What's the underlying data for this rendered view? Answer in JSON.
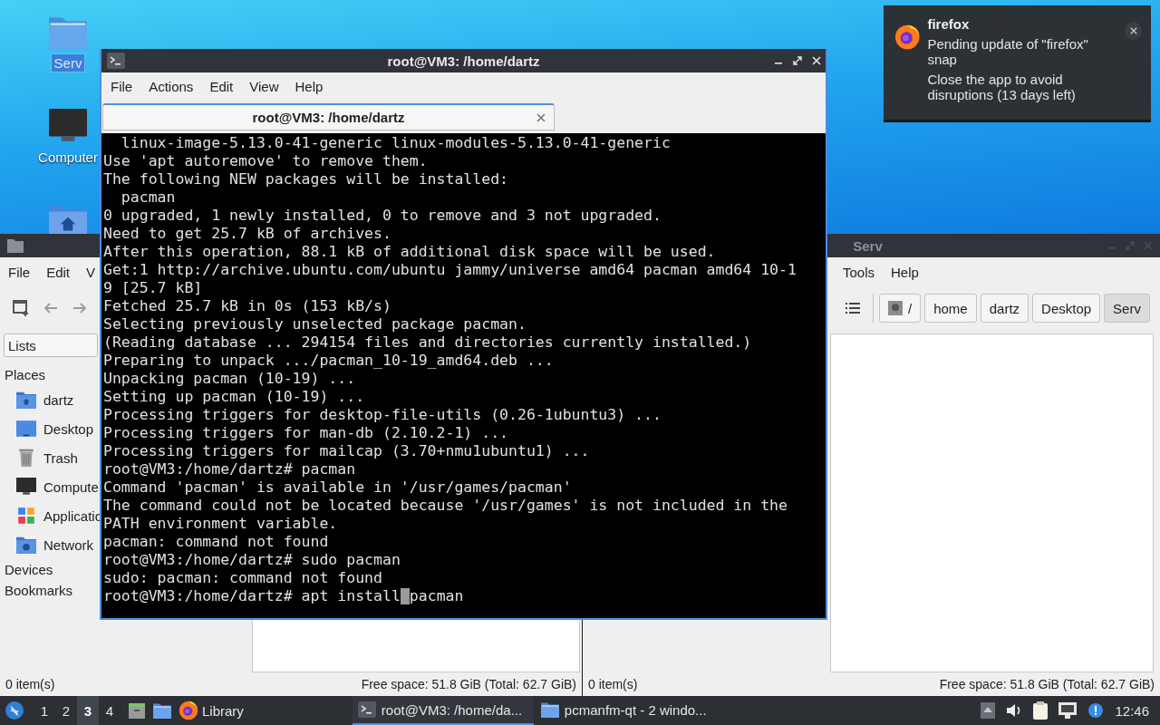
{
  "desktop": {
    "icons": [
      {
        "kind": "folder",
        "label": "Serv",
        "selected": true
      },
      {
        "kind": "computer",
        "label": "Computer",
        "selected": false
      },
      {
        "kind": "home-folder"
      }
    ]
  },
  "file_manager_left": {
    "menu": [
      "File",
      "Edit",
      "V"
    ],
    "location_combo": "Lists",
    "sidebar": [
      {
        "title": "Places",
        "items": [
          {
            "kind": "home",
            "label": "dartz"
          },
          {
            "kind": "desktop",
            "label": "Desktop"
          },
          {
            "kind": "trash",
            "label": "Trash"
          },
          {
            "kind": "computer",
            "label": "Compute"
          },
          {
            "kind": "applications",
            "label": "Applicatio"
          },
          {
            "kind": "network",
            "label": "Network"
          }
        ]
      },
      {
        "title": "Devices"
      },
      {
        "title": "Bookmarks"
      }
    ],
    "status_bar": {
      "items": "0 item(s)",
      "free_space": "Free space: 51.8 GiB (Total: 62.7 GiB)"
    }
  },
  "file_manager_right": {
    "title": "Serv",
    "menu": [
      "Tools",
      "Help"
    ],
    "path": [
      {
        "kind": "root",
        "label": "/",
        "selected": false
      },
      {
        "kind": "dir",
        "label": "home",
        "selected": false
      },
      {
        "kind": "dir",
        "label": "dartz",
        "selected": false
      },
      {
        "kind": "dir",
        "label": "Desktop",
        "selected": false
      },
      {
        "kind": "dir",
        "label": "Serv",
        "selected": true
      }
    ],
    "status_bar": {
      "items": "0 item(s)",
      "free_space": "Free space: 51.8 GiB (Total: 62.7 GiB)"
    }
  },
  "terminal": {
    "title": "root@VM3: /home/dartz",
    "menu": [
      "File",
      "Actions",
      "Edit",
      "View",
      "Help"
    ],
    "tabs": [
      {
        "label": "root@VM3: /home/dartz",
        "selected": true
      }
    ],
    "lines": [
      "  linux-image-5.13.0-41-generic linux-modules-5.13.0-41-generic",
      "Use 'apt autoremove' to remove them.",
      "The following NEW packages will be installed:",
      "  pacman",
      "0 upgraded, 1 newly installed, 0 to remove and 3 not upgraded.",
      "Need to get 25.7 kB of archives.",
      "After this operation, 88.1 kB of additional disk space will be used.",
      "Get:1 http://archive.ubuntu.com/ubuntu jammy/universe amd64 pacman amd64 10-1",
      "9 [25.7 kB]",
      "Fetched 25.7 kB in 0s (153 kB/s)",
      "Selecting previously unselected package pacman.",
      "(Reading database ... 294154 files and directories currently installed.)",
      "Preparing to unpack .../pacman_10-19_amd64.deb ...",
      "Unpacking pacman (10-19) ...",
      "Setting up pacman (10-19) ...",
      "Processing triggers for desktop-file-utils (0.26-1ubuntu3) ...",
      "Processing triggers for man-db (2.10.2-1) ...",
      "Processing triggers for mailcap (3.70+nmu1ubuntu1) ...",
      "root@VM3:/home/dartz# pacman",
      "Command 'pacman' is available in '/usr/games/pacman'",
      "The command could not be located because '/usr/games' is not included in the",
      "PATH environment variable.",
      "pacman: command not found",
      "root@VM3:/home/dartz# sudo pacman",
      "sudo: pacman: command not found"
    ],
    "input": {
      "before_cursor": "root@VM3:/home/dartz# apt install",
      "after_cursor": "pacman"
    }
  },
  "notification": {
    "app": "firefox",
    "body": [
      "Pending update of \"firefox\" snap",
      "Close the app to avoid disruptions (13 days left)"
    ]
  },
  "taskbar": {
    "workspaces": [
      {
        "label": "1",
        "selected": false
      },
      {
        "label": "2",
        "selected": false
      },
      {
        "label": "3",
        "selected": true
      },
      {
        "label": "4",
        "selected": false
      }
    ],
    "launchers": [
      {
        "kind": "file-manager"
      },
      {
        "kind": "folder"
      },
      {
        "kind": "firefox",
        "label": "Library"
      }
    ],
    "tasks": [
      {
        "kind": "terminal",
        "label": "root@VM3: /home/da...",
        "selected": true
      },
      {
        "kind": "folder",
        "label": "pcmanfm-qt - 2 windo...",
        "selected": false
      }
    ],
    "clock": "12:46"
  }
}
